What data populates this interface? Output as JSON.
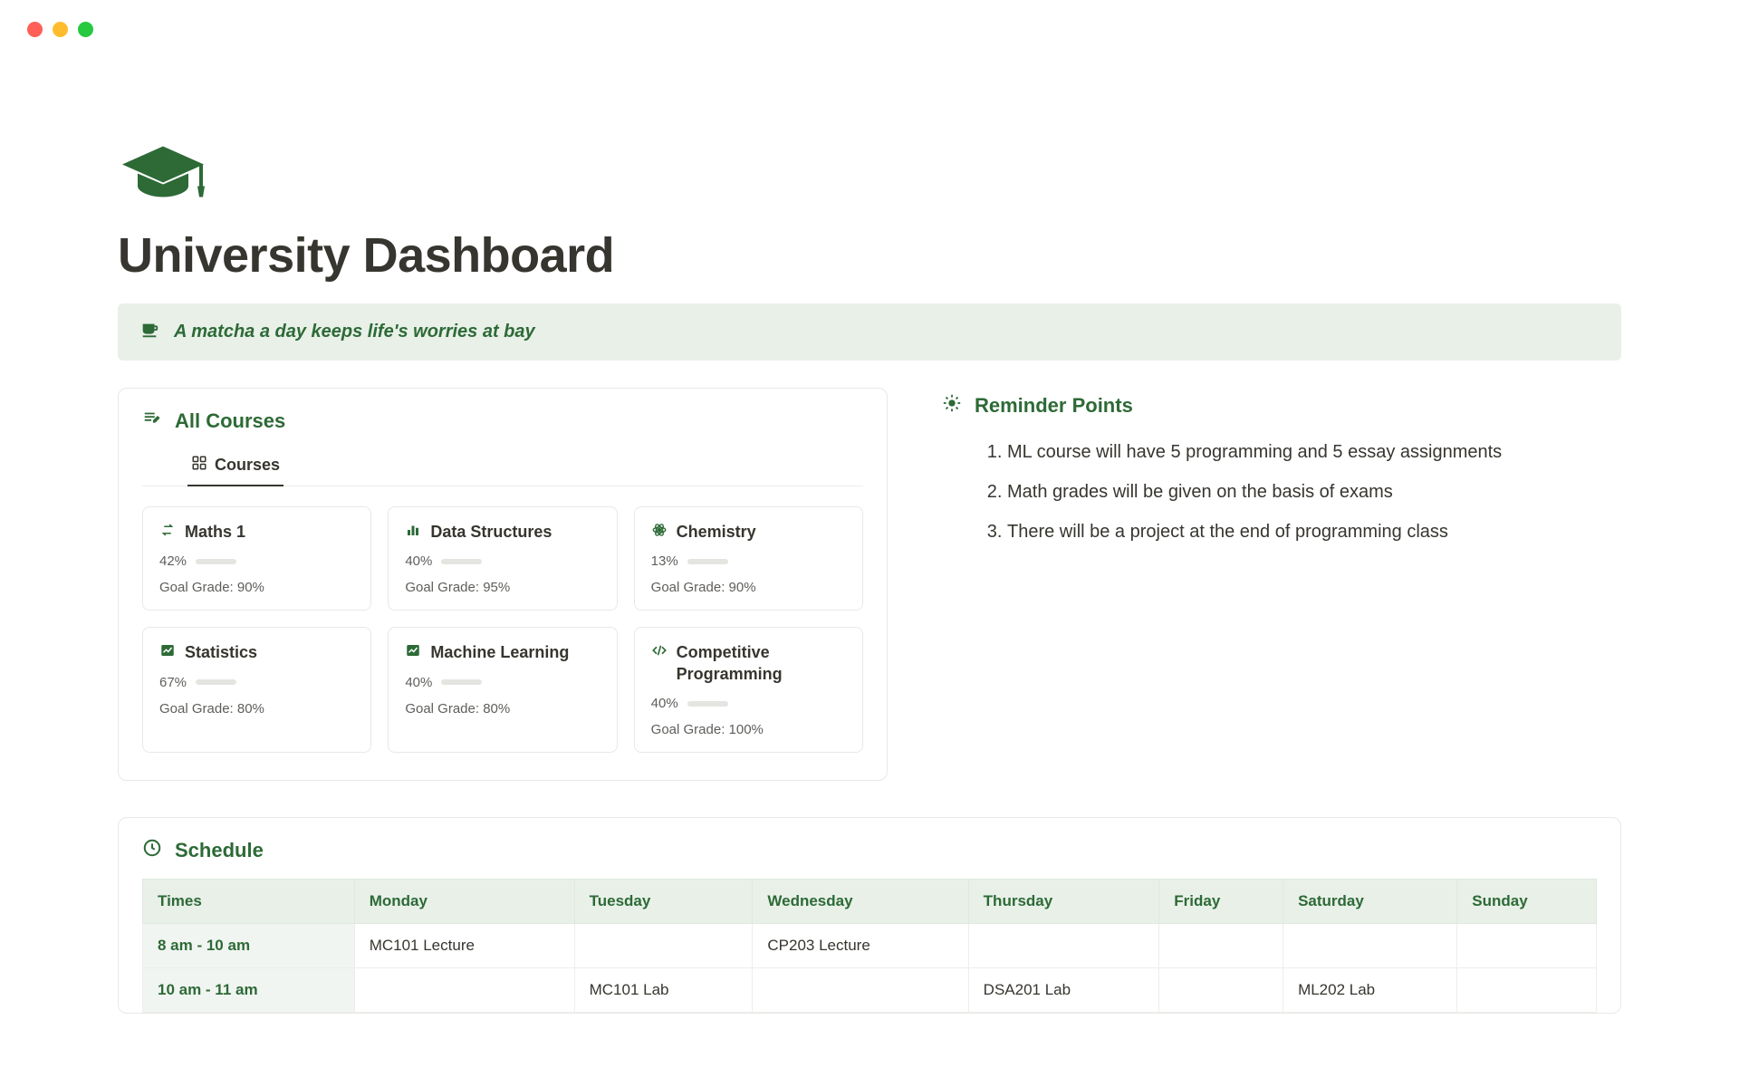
{
  "page": {
    "title": "University Dashboard",
    "quote": "A matcha a day keeps life's worries at bay"
  },
  "courses_panel": {
    "heading": "All Courses",
    "tab_label": "Courses",
    "goal_prefix": "Goal Grade: ",
    "courses": [
      {
        "name": "Maths 1",
        "progress": "42%",
        "progress_pct": 42,
        "goal": "90%",
        "icon": "swap"
      },
      {
        "name": "Data Structures",
        "progress": "40%",
        "progress_pct": 40,
        "goal": "95%",
        "icon": "bar-chart"
      },
      {
        "name": "Chemistry",
        "progress": "13%",
        "progress_pct": 13,
        "goal": "90%",
        "icon": "atom"
      },
      {
        "name": "Statistics",
        "progress": "67%",
        "progress_pct": 67,
        "goal": "80%",
        "icon": "line-chart"
      },
      {
        "name": "Machine Learning",
        "progress": "40%",
        "progress_pct": 40,
        "goal": "80%",
        "icon": "line-chart"
      },
      {
        "name": "Competitive Programming",
        "progress": "40%",
        "progress_pct": 40,
        "goal": "100%",
        "icon": "code"
      }
    ]
  },
  "reminders": {
    "heading": "Reminder Points",
    "items": [
      "ML course will have 5 programming and 5 essay assignments",
      "Math grades will be given on the basis of exams",
      "There will be a project at the end of programming class"
    ]
  },
  "schedule": {
    "heading": "Schedule",
    "columns": [
      "Times",
      "Monday",
      "Tuesday",
      "Wednesday",
      "Thursday",
      "Friday",
      "Saturday",
      "Sunday"
    ],
    "rows": [
      {
        "time": "8 am - 10 am",
        "cells": [
          "MC101 Lecture",
          "",
          "CP203 Lecture",
          "",
          "",
          "",
          ""
        ]
      },
      {
        "time": "10 am - 11 am",
        "cells": [
          "",
          "MC101 Lab",
          "",
          "DSA201 Lab",
          "",
          "ML202 Lab",
          ""
        ]
      }
    ]
  },
  "colors": {
    "accent": "#2d6a36"
  }
}
